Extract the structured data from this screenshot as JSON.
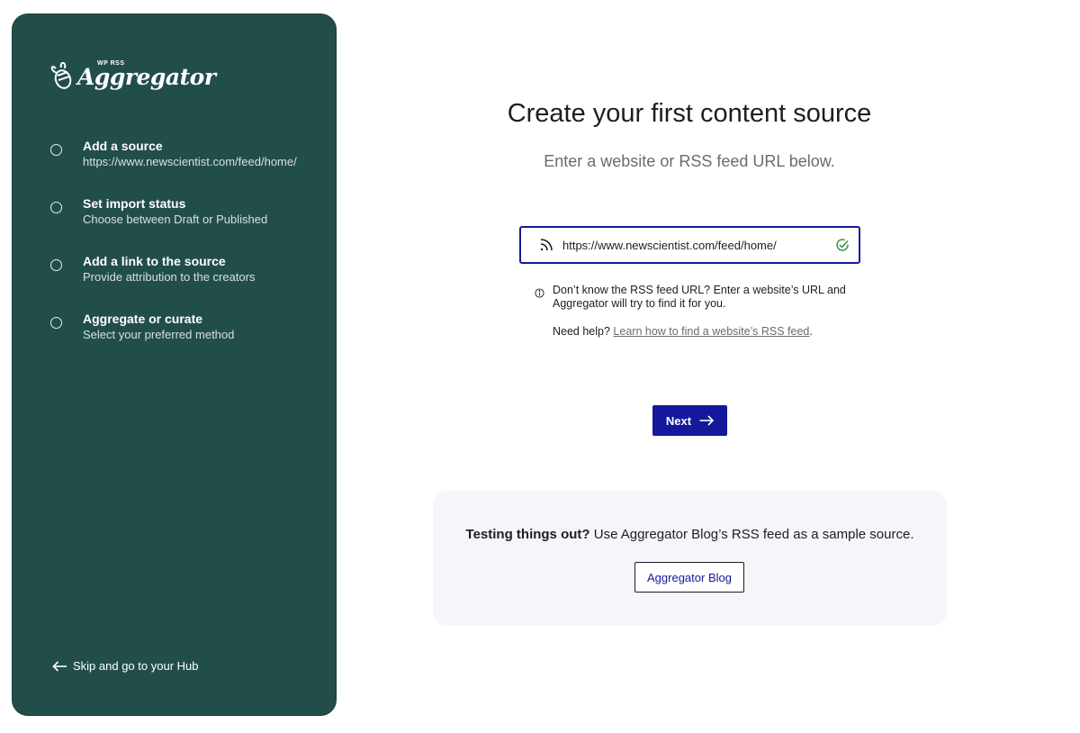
{
  "brand": {
    "small": "WP RSS",
    "name": "Aggregator"
  },
  "steps": [
    {
      "title": "Add a source",
      "subtitle": "https://www.newscientist.com/feed/home/"
    },
    {
      "title": "Set import status",
      "subtitle": "Choose between Draft or Published"
    },
    {
      "title": "Add a link to the source",
      "subtitle": "Provide attribution to the creators"
    },
    {
      "title": "Aggregate or curate",
      "subtitle": "Select your preferred method"
    }
  ],
  "skip_label": "Skip and go to your Hub",
  "main": {
    "title": "Create your first content source",
    "subtitle": "Enter a website or RSS feed URL below.",
    "url_value": "https://www.newscientist.com/feed/home/",
    "help_text": "Don’t know the RSS feed URL? Enter a website’s URL and Aggregator will try to find it for you.",
    "need_help_prefix": "Need help? ",
    "need_help_link": "Learn how to find a website’s RSS feed",
    "need_help_suffix": ".",
    "next_label": "Next"
  },
  "sample": {
    "bold": "Testing things out?",
    "text": " Use Aggregator Blog’s RSS feed as a sample source.",
    "button_label": "Aggregator Blog"
  },
  "colors": {
    "sidebar": "#224e4a",
    "primary": "#13199a",
    "valid": "#2e8b3a",
    "panel": "#f4f6f9"
  }
}
